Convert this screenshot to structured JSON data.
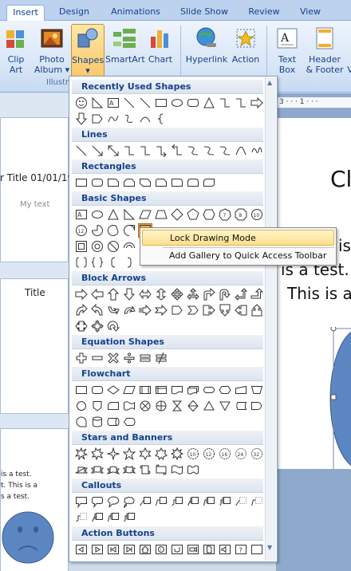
{
  "ribbon": {
    "tabs": [
      "Insert",
      "Design",
      "Animations",
      "Slide Show",
      "Review",
      "View"
    ],
    "active_tab": "Insert",
    "buttons": {
      "clip_art": [
        "Clip",
        "Art"
      ],
      "photo_album": [
        "Photo",
        "Album ▾"
      ],
      "shapes": [
        "Shapes",
        "▾"
      ],
      "smartart": "SmartArt",
      "chart": "Chart",
      "hyperlink": "Hyperlink",
      "action": "Action",
      "text_box": [
        "Text",
        "Box"
      ],
      "header_footer": [
        "Header",
        "& Footer"
      ],
      "partial": "V"
    },
    "group_label": "Illustr"
  },
  "slides_pane": {
    "thumb1_title": "r Title 01/01/19",
    "thumb1_body": "My text",
    "thumb2_title": "Title",
    "thumb3_lines": [
      "is a test.",
      "t. This is a",
      "s a test."
    ]
  },
  "editor": {
    "ruler": "3 · · · 1 · · ·",
    "title_partial": "Cl",
    "line1": "is",
    "line2": "is a test.",
    "line3": "This is a"
  },
  "gallery": {
    "categories": [
      "Recently Used Shapes",
      "Lines",
      "Rectangles",
      "Basic Shapes",
      "Block Arrows",
      "Equation Shapes",
      "Flowchart",
      "Stars and Banners",
      "Callouts",
      "Action Buttons"
    ]
  },
  "context_menu": {
    "items": [
      "Lock Drawing Mode",
      "Add Gallery to Quick Access Toolbar"
    ],
    "highlighted": "Lock Drawing Mode"
  },
  "colors": {
    "accent": "#15428b",
    "highlight": "#fddf8c",
    "smiley": "#5b86c2"
  }
}
